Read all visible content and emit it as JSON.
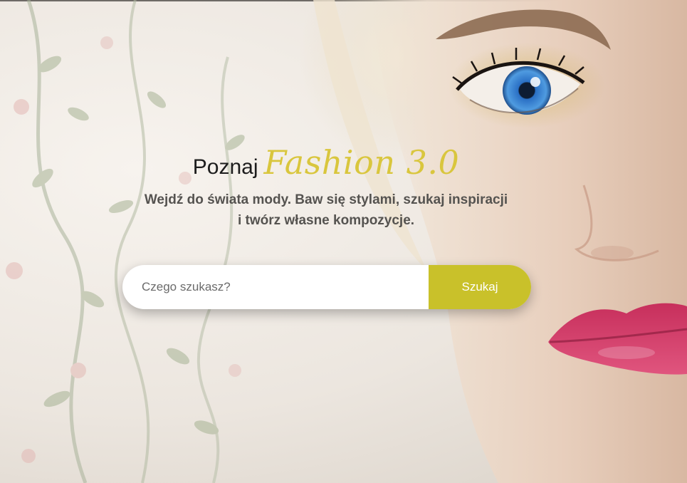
{
  "hero": {
    "headline_lead": "Poznaj",
    "headline_accent": "Fashion 3.0",
    "subtitle_line1": "Wejdź do świata mody. Baw się stylami, szukaj inspiracji",
    "subtitle_line2": "i twórz własne kompozycje."
  },
  "search": {
    "placeholder": "Czego szukasz?",
    "value": "",
    "button_label": "Szukaj"
  },
  "colors": {
    "accent": "#d9c63d",
    "button": "#c9c12a",
    "subtitle": "#555350",
    "lips": "#d8456f",
    "iris": "#3a86d4"
  }
}
